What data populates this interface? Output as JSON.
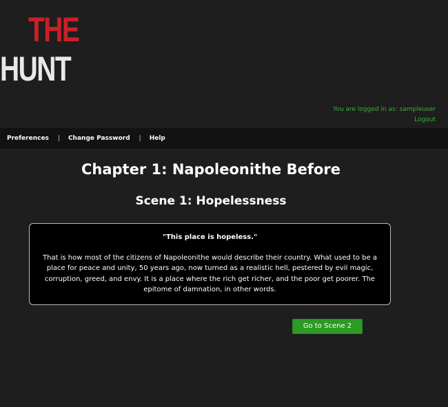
{
  "logo": {
    "line1": "THE",
    "line2": "HUNT"
  },
  "user": {
    "logged_in_text": "You are logged in as: sampleuser",
    "logout_label": "Logout"
  },
  "nav": {
    "items": [
      {
        "label": "Preferences"
      },
      {
        "label": "Change Password"
      },
      {
        "label": "Help"
      }
    ],
    "separator": "|"
  },
  "content": {
    "chapter_title": "Chapter 1: Napoleonithe Before",
    "scene_title": "Scene 1: Hopelessness",
    "quote": "\"This place is hopeless.\"",
    "paragraph": "That is how most of the citizens of Napoleonithe would describe their country. What used to be a place for peace and unity, 50 years ago, now turned as a realistic hell, pestered by evil magic, corruption, greed, and envy. It is a place where the rich get richer, and the poor get poorer. The epitome of damnation, in other words.",
    "next_button_label": "Go to Scene 2"
  },
  "colors": {
    "background": "#1e1e1e",
    "navbar": "#121212",
    "logo_red": "#c8202a",
    "logo_white": "#e8e8e8",
    "login_green": "#3cae3a",
    "button_green": "#2c9a24",
    "box_background": "#000000"
  }
}
